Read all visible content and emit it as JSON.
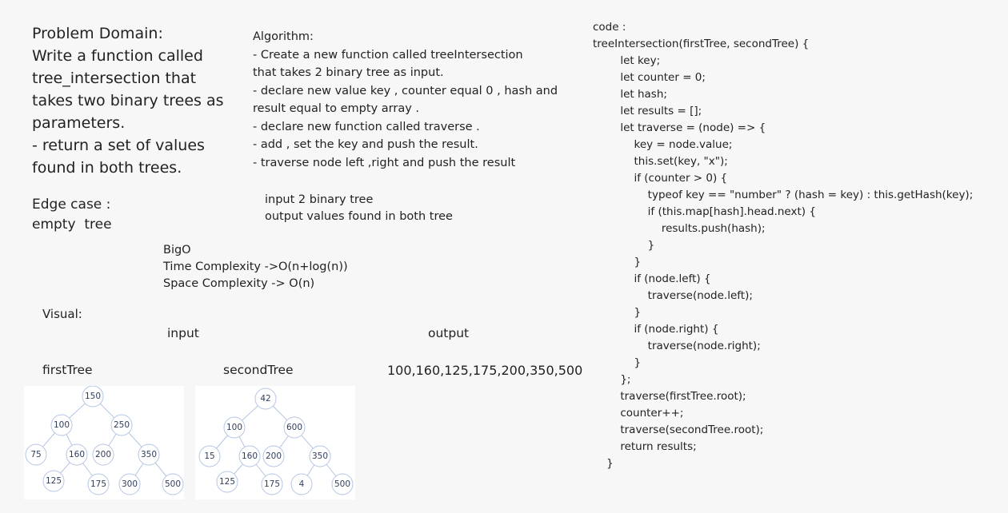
{
  "problem": {
    "lines": [
      "Problem Domain:",
      "Write a function called",
      "tree_intersection that",
      "takes two binary trees as",
      "parameters.",
      "- return a set of values",
      "found in both trees."
    ]
  },
  "algorithm": {
    "lines": [
      "Algorithm:",
      "- Create a new function called treeIntersection",
      "that takes 2 binary tree as input.",
      "- declare new value key , counter equal 0 , hash and",
      "result equal to empty array .",
      "- declare new function called traverse .",
      "- add , set the key and push the result.",
      "- traverse node left ,right and push the result"
    ]
  },
  "edge_case": {
    "lines": [
      "Edge case :",
      "empty  tree"
    ]
  },
  "io": {
    "lines": [
      "input 2 binary tree",
      "output values found in both tree"
    ]
  },
  "bigo": {
    "lines": [
      "BigO",
      "Time Complexity ->O(n+log(n))",
      "Space Complexity -> O(n)"
    ]
  },
  "visual": {
    "label": "Visual:",
    "input_label": "input",
    "output_label": "output",
    "first_tree_label": "firstTree",
    "second_tree_label": "secondTree",
    "output_values": "100,160,125,175,200,350,500"
  },
  "trees": {
    "first": {
      "nodes": [
        "150",
        "100",
        "250",
        "75",
        "160",
        "200",
        "350",
        "125",
        "175",
        "300",
        "500"
      ]
    },
    "second": {
      "nodes": [
        "42",
        "100",
        "600",
        "15",
        "160",
        "200",
        "350",
        "125",
        "175",
        "4",
        "500"
      ]
    }
  },
  "code": {
    "lines": [
      "code :",
      "treeIntersection(firstTree, secondTree) {",
      "        let key;",
      "        let counter = 0;",
      "        let hash;",
      "        let results = [];",
      "        let traverse = (node) => {",
      "            key = node.value;",
      "            this.set(key, \"x\");",
      "            if (counter > 0) {",
      "                typeof key == \"number\" ? (hash = key) : this.getHash(key);",
      "                if (this.map[hash].head.next) {",
      "                    results.push(hash);",
      "                }",
      "            }",
      "            if (node.left) {",
      "                traverse(node.left);",
      "            }",
      "            if (node.right) {",
      "                traverse(node.right);",
      "            }",
      "        };",
      "        traverse(firstTree.root);",
      "        counter++;",
      "        traverse(secondTree.root);",
      "        return results;",
      "    }"
    ]
  },
  "colors": {
    "node_stroke": "#b5c6e3",
    "node_text": "#2f3e5c",
    "panel_bg": "#ffffff",
    "page_bg": "#f7f7f7"
  }
}
